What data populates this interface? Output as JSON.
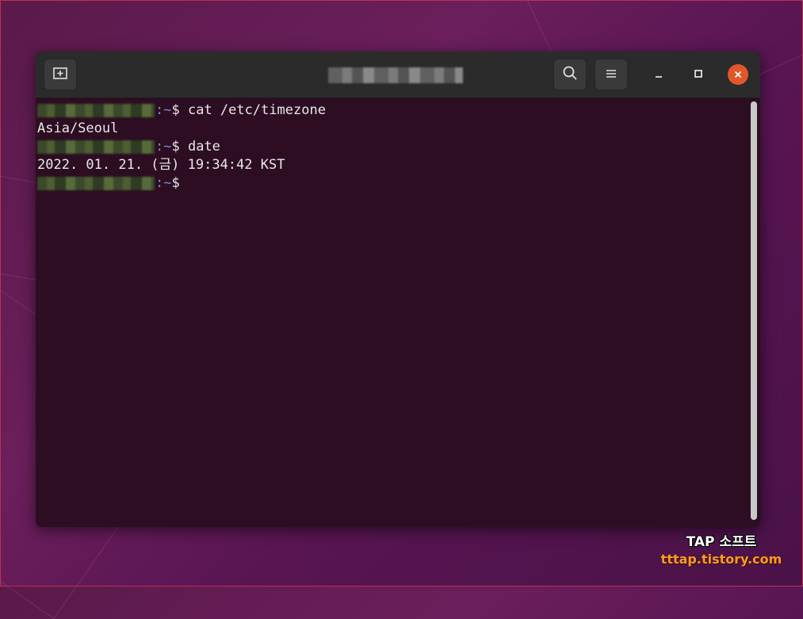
{
  "window": {
    "buttons": {
      "new_tab_icon": "new-tab-icon",
      "search_icon": "search-icon",
      "menu_icon": "hamburger-menu-icon",
      "minimize_icon": "minimize-icon",
      "maximize_icon": "maximize-icon",
      "close_icon": "close-icon"
    },
    "colors": {
      "terminal_bg": "#2c0d22",
      "headerbar_bg": "#2b2b2b",
      "close_button": "#e2572a",
      "prompt_path": "#7a8ad0"
    }
  },
  "terminal": {
    "lines": [
      {
        "type": "prompt",
        "sep": ":~",
        "dollar": "$",
        "command": " cat /etc/timezone"
      },
      {
        "type": "output",
        "text": "Asia/Seoul"
      },
      {
        "type": "prompt",
        "sep": ":~",
        "dollar": "$",
        "command": " date"
      },
      {
        "type": "output",
        "text": "2022. 01. 21. (금) 19:34:42 KST"
      },
      {
        "type": "prompt",
        "sep": ":~",
        "dollar": "$",
        "command": ""
      }
    ]
  },
  "watermark": {
    "title": "TAP 소프트",
    "url": "tttap.tistory.com"
  }
}
